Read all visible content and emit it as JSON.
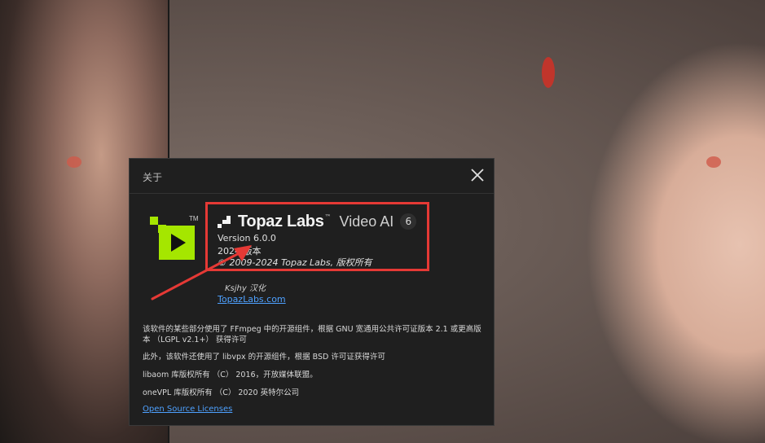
{
  "colors": {
    "dialog_bg": "#1f1f1f",
    "accent_logo": "#a5e600",
    "highlight_red": "#e53935",
    "link_blue": "#4ea1ff"
  },
  "dialog": {
    "title": "关于",
    "close_icon": "close-icon",
    "app_logo_icon": "topaz-video-ai-logo-icon",
    "app_logo_tm": "TM",
    "brand": {
      "name": "Topaz Labs",
      "tm": "™",
      "product": "Video AI",
      "badge": "6"
    },
    "version": "Version 6.0.0",
    "year_version": "2024 版本",
    "copyright": "© 2009-2024 Topaz Labs,  版权所有",
    "credit": "Ksjhy 汉化",
    "website_link": "TopazLabs.com",
    "paragraphs": [
      "该软件的某些部分使用了 FFmpeg 中的开源组件，根据 GNU 宽通用公共许可证版本 2.1 或更高版本 （LGPL v2.1+） 获得许可",
      "此外，该软件还使用了 libvpx 的开源组件，根据 BSD 许可证获得许可",
      "libaom 库版权所有 （C） 2016，开放媒体联盟。",
      "oneVPL 库版权所有 （C） 2020 英特尔公司"
    ],
    "licenses_link": "Open Source Licenses"
  }
}
